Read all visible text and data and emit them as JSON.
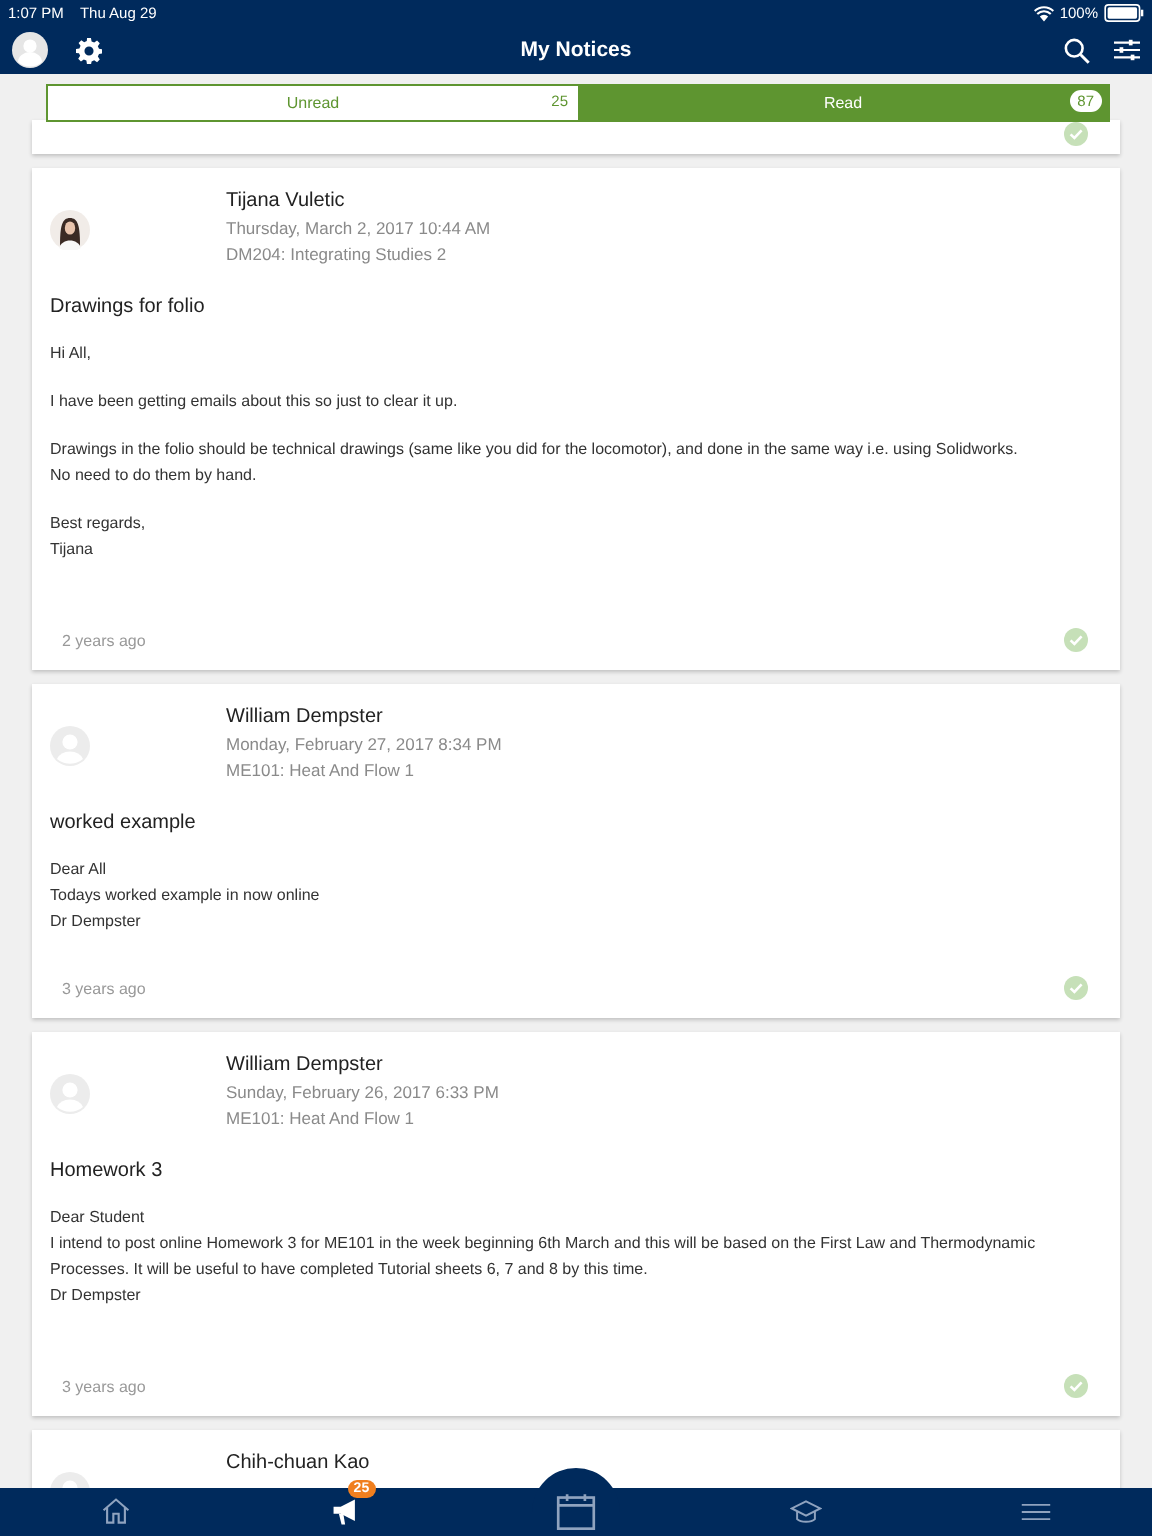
{
  "status_bar": {
    "time": "1:07 PM",
    "date": "Thu Aug 29",
    "battery": "100%"
  },
  "header": {
    "title": "My Notices"
  },
  "tabs": [
    {
      "label": "Unread",
      "count": "25",
      "selected": false
    },
    {
      "label": "Read",
      "count": "87",
      "selected": true
    }
  ],
  "notices": [
    {
      "kind": "stub",
      "read": true
    },
    {
      "kind": "full",
      "avatar": {
        "kind": "photo"
      },
      "author": "Tijana Vuletic",
      "datetime": "Thursday, March 2, 2017 10:44 AM",
      "course": "DM204: Integrating Studies 2",
      "title": "Drawings for folio",
      "paragraphs": [
        [
          "Hi All,"
        ],
        [
          "I have been getting emails about this so just to clear it up."
        ],
        [
          "Drawings in the folio should be technical drawings (same like you did for the locomotor), and done in the same way i.e. using Solidworks.",
          "No need to do them by hand."
        ],
        [
          "Best regards,",
          "Tijana"
        ]
      ],
      "age": "2 years ago",
      "read": true
    },
    {
      "kind": "full",
      "avatar": {
        "kind": "placeholder"
      },
      "author": "William Dempster",
      "datetime": "Monday, February 27, 2017 8:34 PM",
      "course": "ME101: Heat And Flow 1",
      "title": "worked example",
      "paragraphs": [
        [
          "Dear All",
          "Todays worked example in now online",
          "Dr Dempster"
        ]
      ],
      "age": "3 years ago",
      "read": true
    },
    {
      "kind": "full",
      "avatar": {
        "kind": "placeholder"
      },
      "author": "William Dempster",
      "datetime": "Sunday, February 26, 2017 6:33 PM",
      "course": "ME101: Heat And Flow 1",
      "title": "Homework 3",
      "paragraphs": [
        [
          "Dear Student",
          "I intend to post online Homework 3 for ME101 in the week beginning 6th March and this will be based on the First Law and Thermodynamic Processes. It will be useful to have completed Tutorial sheets 6, 7 and 8 by this time.",
          "Dr Dempster"
        ]
      ],
      "age": "3 years ago",
      "read": true
    },
    {
      "kind": "partial",
      "avatar": {
        "kind": "placeholder"
      },
      "author": "Chih-chuan Kao"
    }
  ],
  "tab_bar": [
    {
      "kind": "home",
      "selected": false
    },
    {
      "kind": "notices",
      "badge": "25",
      "selected": true
    },
    {
      "kind": "calendar",
      "selected": false
    },
    {
      "kind": "courses",
      "selected": false
    },
    {
      "kind": "menu",
      "selected": false
    }
  ]
}
